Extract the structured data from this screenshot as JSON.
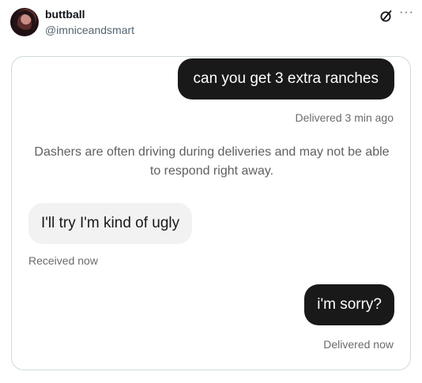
{
  "post": {
    "display_name": "buttball",
    "handle": "@imniceandsmart",
    "icons": {
      "avatar": "profile-avatar",
      "grok": "grok-icon",
      "more": "more-icon"
    },
    "more_glyph": "···"
  },
  "chat": {
    "messages": [
      {
        "direction": "outgoing",
        "text": "can you get 3 extra ranches",
        "status": "Delivered 3 min ago"
      },
      {
        "direction": "incoming",
        "text": "I'll try I'm kind of ugly",
        "status": "Received now"
      },
      {
        "direction": "outgoing",
        "text": "i'm sorry?",
        "status": "Delivered now"
      }
    ],
    "notice": "Dashers are often driving during deliveries and may not be able to respond right away.",
    "colors": {
      "outgoing_bubble": "#191919",
      "incoming_bubble": "#f2f2f2",
      "status_text": "#6b6b6b"
    }
  }
}
